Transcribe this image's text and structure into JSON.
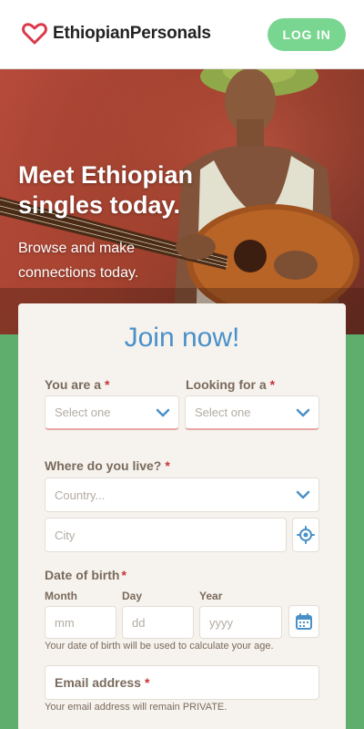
{
  "header": {
    "logo_text": "EthiopianPersonals",
    "login_label": "LOG IN"
  },
  "hero": {
    "title": "Meet Ethiopian singles today.",
    "subtitle": "Browse and make connections today."
  },
  "form": {
    "title": "Join now!",
    "you_are_label": "You are a",
    "looking_for_label": "Looking for a",
    "select_placeholder": "Select one",
    "where_label": "Where do you live?",
    "country_placeholder": "Country...",
    "city_placeholder": "City",
    "dob_label": "Date of birth",
    "month_label": "Month",
    "day_label": "Day",
    "year_label": "Year",
    "month_placeholder": "mm",
    "day_placeholder": "dd",
    "year_placeholder": "yyyy",
    "dob_hint": "Your date of birth will be used to calculate your age.",
    "email_label": "Email address",
    "email_hint": "Your email address will remain PRIVATE.",
    "required_marker": "*"
  },
  "colors": {
    "brand_green": "#79d690",
    "background_green": "#5fae6e",
    "accent_blue": "#4a90c8",
    "required_red": "#c8323a",
    "heart_red": "#d93a4a"
  },
  "icons": {
    "logo": "heart-logo-icon",
    "dropdown": "chevron-down-icon",
    "location": "location-target-icon",
    "calendar": "calendar-icon"
  }
}
